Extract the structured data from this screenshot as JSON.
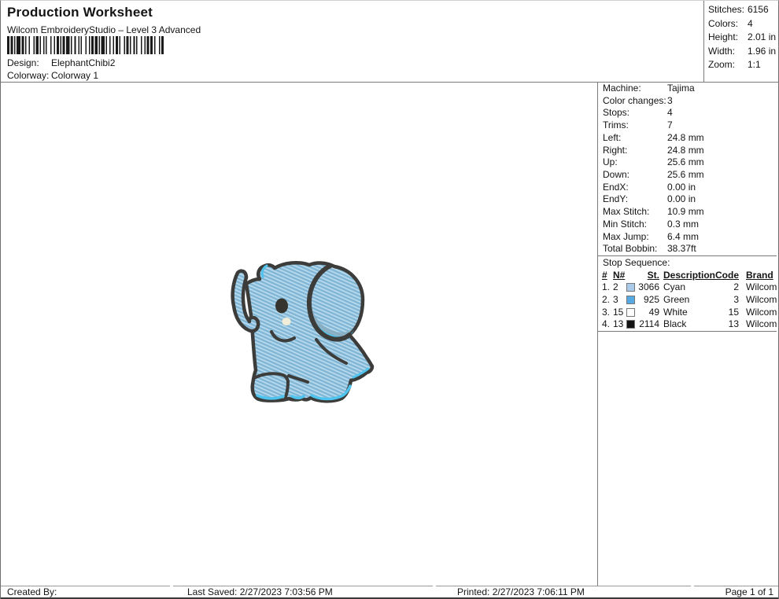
{
  "header": {
    "title": "Production Worksheet",
    "subtitle": "Wilcom EmbroideryStudio – Level 3 Advanced",
    "design_label": "Design:",
    "design_value": "ElephantChibi2",
    "colorway_label": "Colorway:",
    "colorway_value": "Colorway 1"
  },
  "barcode": {
    "pattern": "21211131211213112112111312112111213112121113121121211131121211211311211211131211212113112"
  },
  "stats": {
    "rows": [
      {
        "label": "Stitches:",
        "value": "6156"
      },
      {
        "label": "Colors:",
        "value": "4"
      },
      {
        "label": "Height:",
        "value": "2.01 in"
      },
      {
        "label": "Width:",
        "value": "1.96 in"
      },
      {
        "label": "Zoom:",
        "value": "1:1"
      }
    ]
  },
  "machine_info": {
    "rows": [
      {
        "label": "Machine:",
        "value": "Tajima"
      },
      {
        "label": "Color changes:",
        "value": "3"
      },
      {
        "label": "Stops:",
        "value": "4"
      },
      {
        "label": "Trims:",
        "value": "7"
      },
      {
        "label": "Left:",
        "value": "24.8 mm"
      },
      {
        "label": "Right:",
        "value": "24.8 mm"
      },
      {
        "label": "Up:",
        "value": "25.6 mm"
      },
      {
        "label": "Down:",
        "value": "25.6 mm"
      },
      {
        "label": "EndX:",
        "value": "0.00 in"
      },
      {
        "label": "EndY:",
        "value": "0.00 in"
      },
      {
        "label": "Max Stitch:",
        "value": "10.9 mm"
      },
      {
        "label": "Min Stitch:",
        "value": "0.3 mm"
      },
      {
        "label": "Max Jump:",
        "value": "6.4 mm"
      },
      {
        "label": "Total Bobbin:",
        "value": "38.37ft"
      }
    ]
  },
  "stop_sequence": {
    "title": "Stop Sequence:",
    "columns": {
      "num": "#",
      "n": "N#",
      "st": "St.",
      "description": "Description",
      "code": "Code",
      "brand": "Brand"
    },
    "rows": [
      {
        "num": "1.",
        "n": "2",
        "swatch": "#a9cbe9",
        "st": "3066",
        "description": "Cyan",
        "code": "2",
        "brand": "Wilcom"
      },
      {
        "num": "2.",
        "n": "3",
        "swatch": "#57a9e4",
        "st": "925",
        "description": "Green",
        "code": "3",
        "brand": "Wilcom"
      },
      {
        "num": "3.",
        "n": "15",
        "swatch": "#ffffff",
        "st": "49",
        "description": "White",
        "code": "15",
        "brand": "Wilcom"
      },
      {
        "num": "4.",
        "n": "13",
        "swatch": "#141414",
        "st": "2114",
        "description": "Black",
        "code": "13",
        "brand": "Wilcom"
      }
    ]
  },
  "design": {
    "palette": {
      "body_blue": "#8fc2df",
      "accent_cyan": "#4ec3ee",
      "ear_shade": "#86abc0",
      "outline": "#3c3c3a",
      "eye": "#35342f",
      "cheek": "#f1edd9"
    }
  },
  "footer": {
    "created_by": "Created By:",
    "last_saved": "Last Saved: 2/27/2023 7:03:56 PM",
    "printed": "Printed: 2/27/2023 7:06:11 PM",
    "page": "Page 1 of 1"
  }
}
